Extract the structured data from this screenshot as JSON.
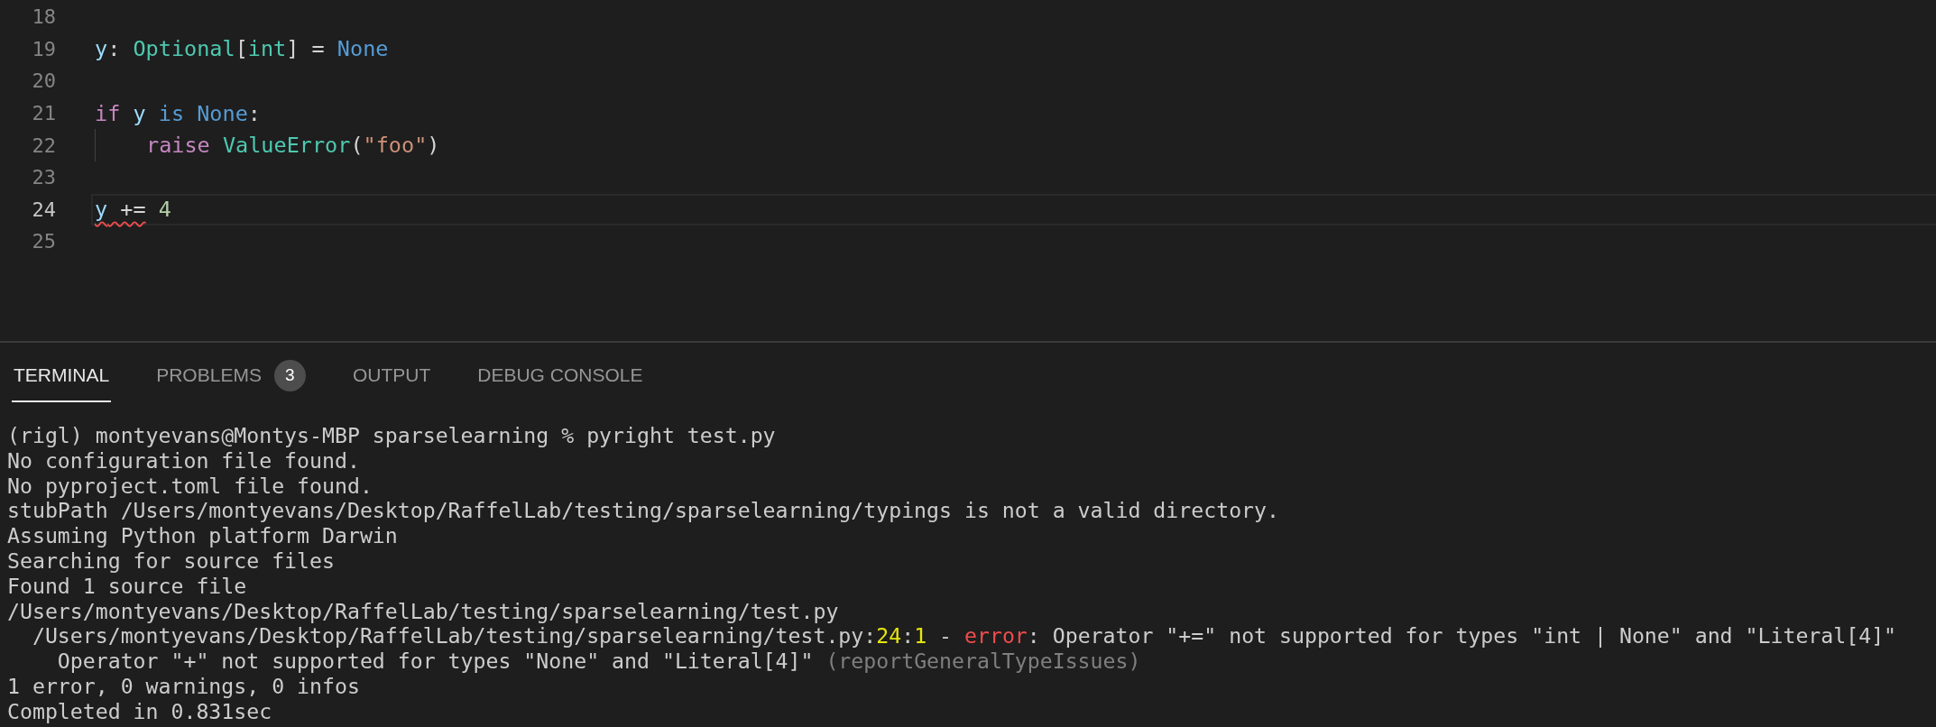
{
  "editor": {
    "lines": [
      {
        "number": "18",
        "active": false,
        "indented": false
      },
      {
        "number": "19",
        "active": false,
        "indented": false,
        "tokens": [
          {
            "text": "y",
            "kind": "variable",
            "error": false
          },
          {
            "text": ": ",
            "kind": "punct",
            "error": false
          },
          {
            "text": "Optional",
            "kind": "type",
            "error": false
          },
          {
            "text": "[",
            "kind": "punct",
            "error": false
          },
          {
            "text": "int",
            "kind": "type",
            "error": false
          },
          {
            "text": "] = ",
            "kind": "punct",
            "error": false
          },
          {
            "text": "None",
            "kind": "constant",
            "error": false
          }
        ]
      },
      {
        "number": "20",
        "active": false,
        "indented": false
      },
      {
        "number": "21",
        "active": false,
        "indented": false,
        "tokens": [
          {
            "text": "if",
            "kind": "keyword",
            "error": false
          },
          {
            "text": " y",
            "kind": "variable",
            "error": false
          },
          {
            "text": " is",
            "kind": "constant",
            "error": false
          },
          {
            "text": " None",
            "kind": "constant",
            "error": false
          },
          {
            "text": ":",
            "kind": "punct",
            "error": false
          }
        ]
      },
      {
        "number": "22",
        "active": false,
        "indented": true,
        "tokens": [
          {
            "text": "raise",
            "kind": "keyword",
            "error": false
          },
          {
            "text": " ValueError",
            "kind": "type",
            "error": false
          },
          {
            "text": "(",
            "kind": "punct",
            "error": false
          },
          {
            "text": "\"foo\"",
            "kind": "string",
            "error": false
          },
          {
            "text": ")",
            "kind": "punct",
            "error": false
          }
        ]
      },
      {
        "number": "23",
        "active": false,
        "indented": false
      },
      {
        "number": "24",
        "active": true,
        "indented": false,
        "tokens": [
          {
            "text": "y",
            "kind": "variable",
            "error": true
          },
          {
            "text": " +=",
            "kind": "punct",
            "error": true
          },
          {
            "text": " 4",
            "kind": "number",
            "error": false
          }
        ]
      },
      {
        "number": "25",
        "active": false,
        "indented": false
      }
    ]
  },
  "panel": {
    "tabs": [
      {
        "label": "TERMINAL",
        "selected": true
      },
      {
        "label": "PROBLEMS",
        "selected": false,
        "badge": "3"
      },
      {
        "label": "OUTPUT",
        "selected": false
      },
      {
        "label": "DEBUG CONSOLE",
        "selected": false
      }
    ],
    "terminal_lines": [
      [
        {
          "text": "(rigl) montyevans@Montys-MBP sparselearning % pyright test.py",
          "kind": "plain"
        }
      ],
      [
        {
          "text": "No configuration file found.",
          "kind": "plain"
        }
      ],
      [
        {
          "text": "No pyproject.toml file found.",
          "kind": "plain"
        }
      ],
      [
        {
          "text": "stubPath /Users/montyevans/Desktop/RaffelLab/testing/sparselearning/typings is not a valid directory.",
          "kind": "plain"
        }
      ],
      [
        {
          "text": "Assuming Python platform Darwin",
          "kind": "plain"
        }
      ],
      [
        {
          "text": "Searching for source files",
          "kind": "plain"
        }
      ],
      [
        {
          "text": "Found 1 source file",
          "kind": "plain"
        }
      ],
      [
        {
          "text": "/Users/montyevans/Desktop/RaffelLab/testing/sparselearning/test.py",
          "kind": "plain"
        }
      ],
      [
        {
          "text": "  /Users/montyevans/Desktop/RaffelLab/testing/sparselearning/test.py:",
          "kind": "plain"
        },
        {
          "text": "24",
          "kind": "highlight"
        },
        {
          "text": ":",
          "kind": "plain"
        },
        {
          "text": "1",
          "kind": "highlight"
        },
        {
          "text": " - ",
          "kind": "plain"
        },
        {
          "text": "error",
          "kind": "error"
        },
        {
          "text": ": Operator \"+=\" not supported for types \"int | None\" and \"Literal[4]\"",
          "kind": "plain"
        }
      ],
      [
        {
          "text": "    Operator \"+\" not supported for types \"None\" and \"Literal[4]\" ",
          "kind": "plain"
        },
        {
          "text": "(reportGeneralTypeIssues)",
          "kind": "dim"
        }
      ],
      [
        {
          "text": "1 error, 0 warnings, 0 infos",
          "kind": "plain"
        }
      ],
      [
        {
          "text": "Completed in 0.831sec",
          "kind": "plain"
        }
      ]
    ]
  }
}
